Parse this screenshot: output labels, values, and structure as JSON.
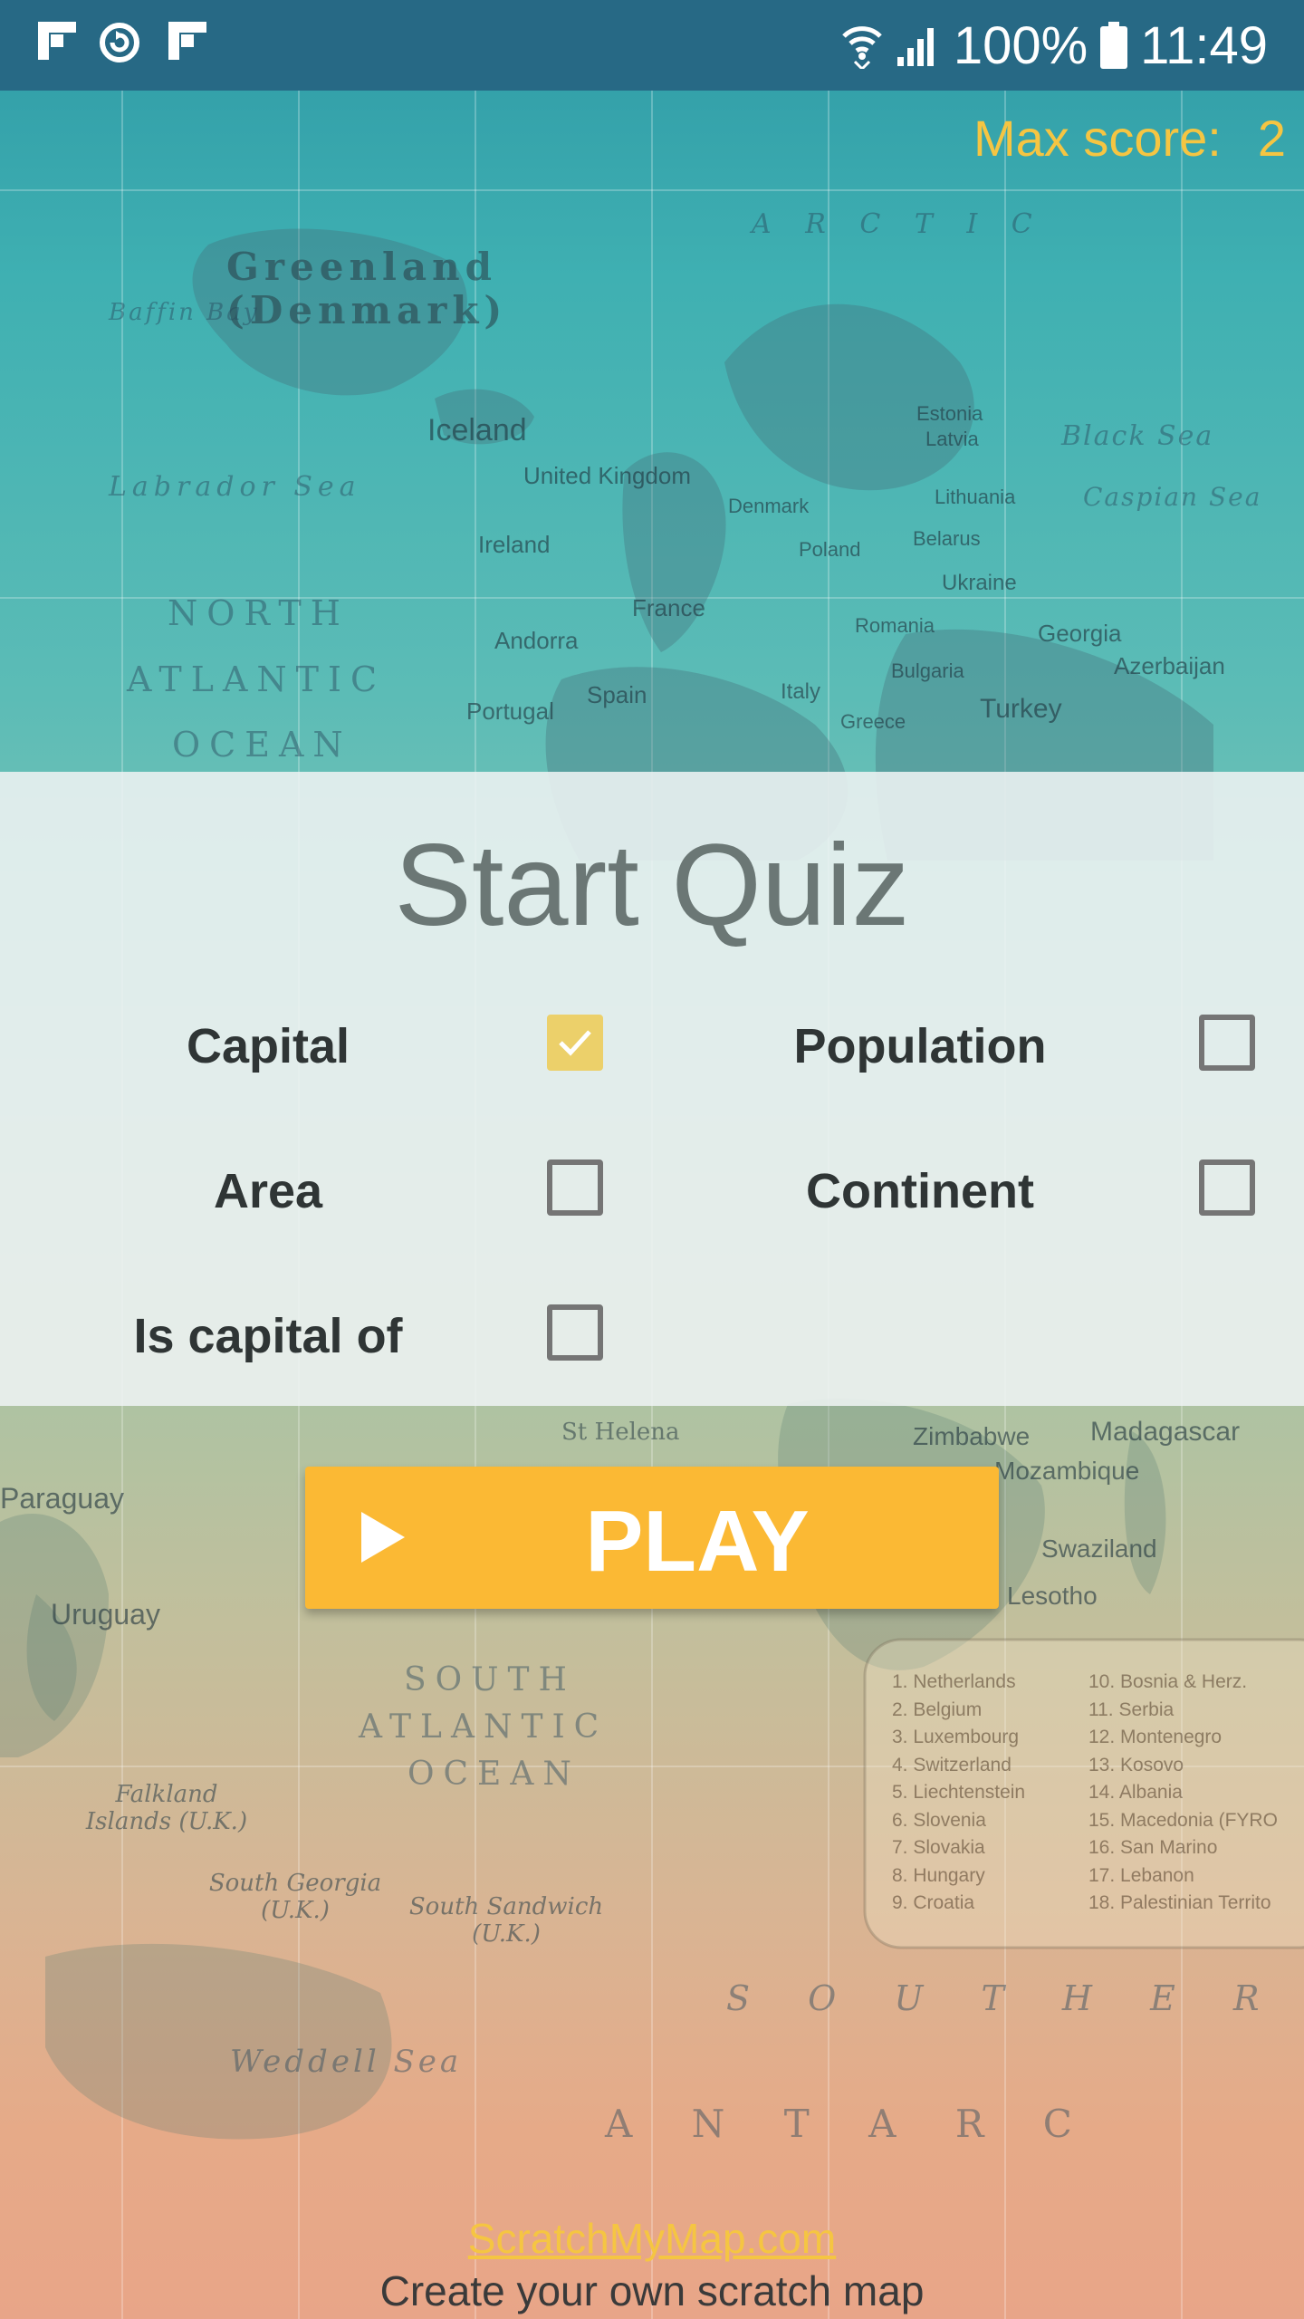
{
  "status_bar": {
    "battery": "100%",
    "time": "11:49",
    "left_icons": [
      "flipboard-icon",
      "sync-icon",
      "flipboard-icon"
    ],
    "right_icons": [
      "wifi-icon",
      "signal-icon",
      "battery-icon"
    ]
  },
  "score": {
    "label": "Max score:",
    "value": "2"
  },
  "quiz": {
    "title": "Start Quiz",
    "options": [
      {
        "label": "Capital",
        "checked": true
      },
      {
        "label": "Population",
        "checked": false
      },
      {
        "label": "Area",
        "checked": false
      },
      {
        "label": "Continent",
        "checked": false
      },
      {
        "label": "Is capital of",
        "checked": false
      }
    ]
  },
  "play_button": {
    "label": "PLAY"
  },
  "footer": {
    "link": "ScratchMyMap.com",
    "tagline": "Create your own scratch map"
  },
  "colors": {
    "status_bar": "#276985",
    "accent": "#fbb934",
    "score_text": "#f5c542",
    "checkbox_checked": "#ecd06a"
  },
  "map_labels": {
    "greenland": "Greenland",
    "denmark": "(Denmark)",
    "iceland": "Iceland",
    "baffin": "Baffin Bay",
    "labrador": "Labrador Sea",
    "north": "NORTH",
    "atlantic": "ATLANTIC",
    "ocean": "OCEAN",
    "arctic": "A R C T I C",
    "united_kingdom": "United Kingdom",
    "ireland": "Ireland",
    "france": "France",
    "spain": "Spain",
    "portugal": "Portugal",
    "andorra": "Andorra",
    "italy": "Italy",
    "turkey": "Turkey",
    "georgia": "Georgia",
    "azerbaijan": "Azerbaijan",
    "ukraine": "Ukraine",
    "belarus": "Belarus",
    "lithuania": "Lithuania",
    "latvia": "Latvia",
    "estonia": "Estonia",
    "denmark_c": "Denmark",
    "poland": "Poland",
    "romania": "Romania",
    "bulgaria": "Bulgaria",
    "greece": "Greece",
    "black_sea": "Black Sea",
    "caspian": "Caspian Sea",
    "zimbabwe": "Zimbabwe",
    "madagascar": "Madagascar",
    "mozambique": "Mozambique",
    "swaziland": "Swaziland",
    "lesotho": "Lesotho",
    "uruguay": "Uruguay",
    "paraguay": "Paraguay",
    "south": "SOUTH",
    "atlantic_s": "ATLANTIC",
    "ocean_s": "OCEAN",
    "falkland": "Falkland Islands (U.K.)",
    "south_georgia": "South Georgia (U.K.)",
    "south_sandwich": "South Sandwich (U.K.)",
    "weddell": "Weddell Sea",
    "antarctica": "A N T A R C",
    "southern": "S O U T H E R",
    "st_helena": "St Helena",
    "legend": [
      "1. Netherlands",
      "2. Belgium",
      "3. Luxembourg",
      "4. Switzerland",
      "5. Liechtenstein",
      "6. Slovenia",
      "7. Slovakia",
      "8. Hungary",
      "9. Croatia",
      "10. Bosnia & Herz.",
      "11. Serbia",
      "12. Montenegro",
      "13. Kosovo",
      "14. Albania",
      "15. Macedonia (FYRO",
      "16. San Marino",
      "17. Lebanon",
      "18. Palestinian Territo"
    ]
  }
}
